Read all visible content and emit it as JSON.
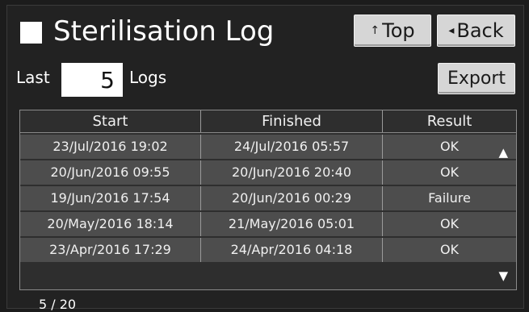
{
  "header": {
    "title": "Sterilisation Log",
    "top_label": "Top",
    "back_label": "Back",
    "top_icon": "↑",
    "back_icon": "◂"
  },
  "controls": {
    "last_label": "Last",
    "count_value": "5",
    "logs_label": "Logs",
    "export_label": "Export"
  },
  "table": {
    "columns": [
      "Start",
      "Finished",
      "Result"
    ],
    "rows": [
      {
        "start": "23/Jul/2016 19:02",
        "finished": "24/Jul/2016 05:57",
        "result": "OK"
      },
      {
        "start": "20/Jun/2016 09:55",
        "finished": "20/Jun/2016 20:40",
        "result": "OK"
      },
      {
        "start": "19/Jun/2016 17:54",
        "finished": "20/Jun/2016 00:29",
        "result": "Failure"
      },
      {
        "start": "20/May/2016 18:14",
        "finished": "21/May/2016 05:01",
        "result": "OK"
      },
      {
        "start": "23/Apr/2016 17:29",
        "finished": "24/Apr/2016 04:18",
        "result": "OK"
      }
    ],
    "scroll_up_icon": "▲",
    "scroll_down_icon": "▼"
  },
  "pager": "5 / 20",
  "colors": {
    "background": "#1c1c1c",
    "row": "#4d4d4d",
    "button": "#d6d6d6"
  }
}
